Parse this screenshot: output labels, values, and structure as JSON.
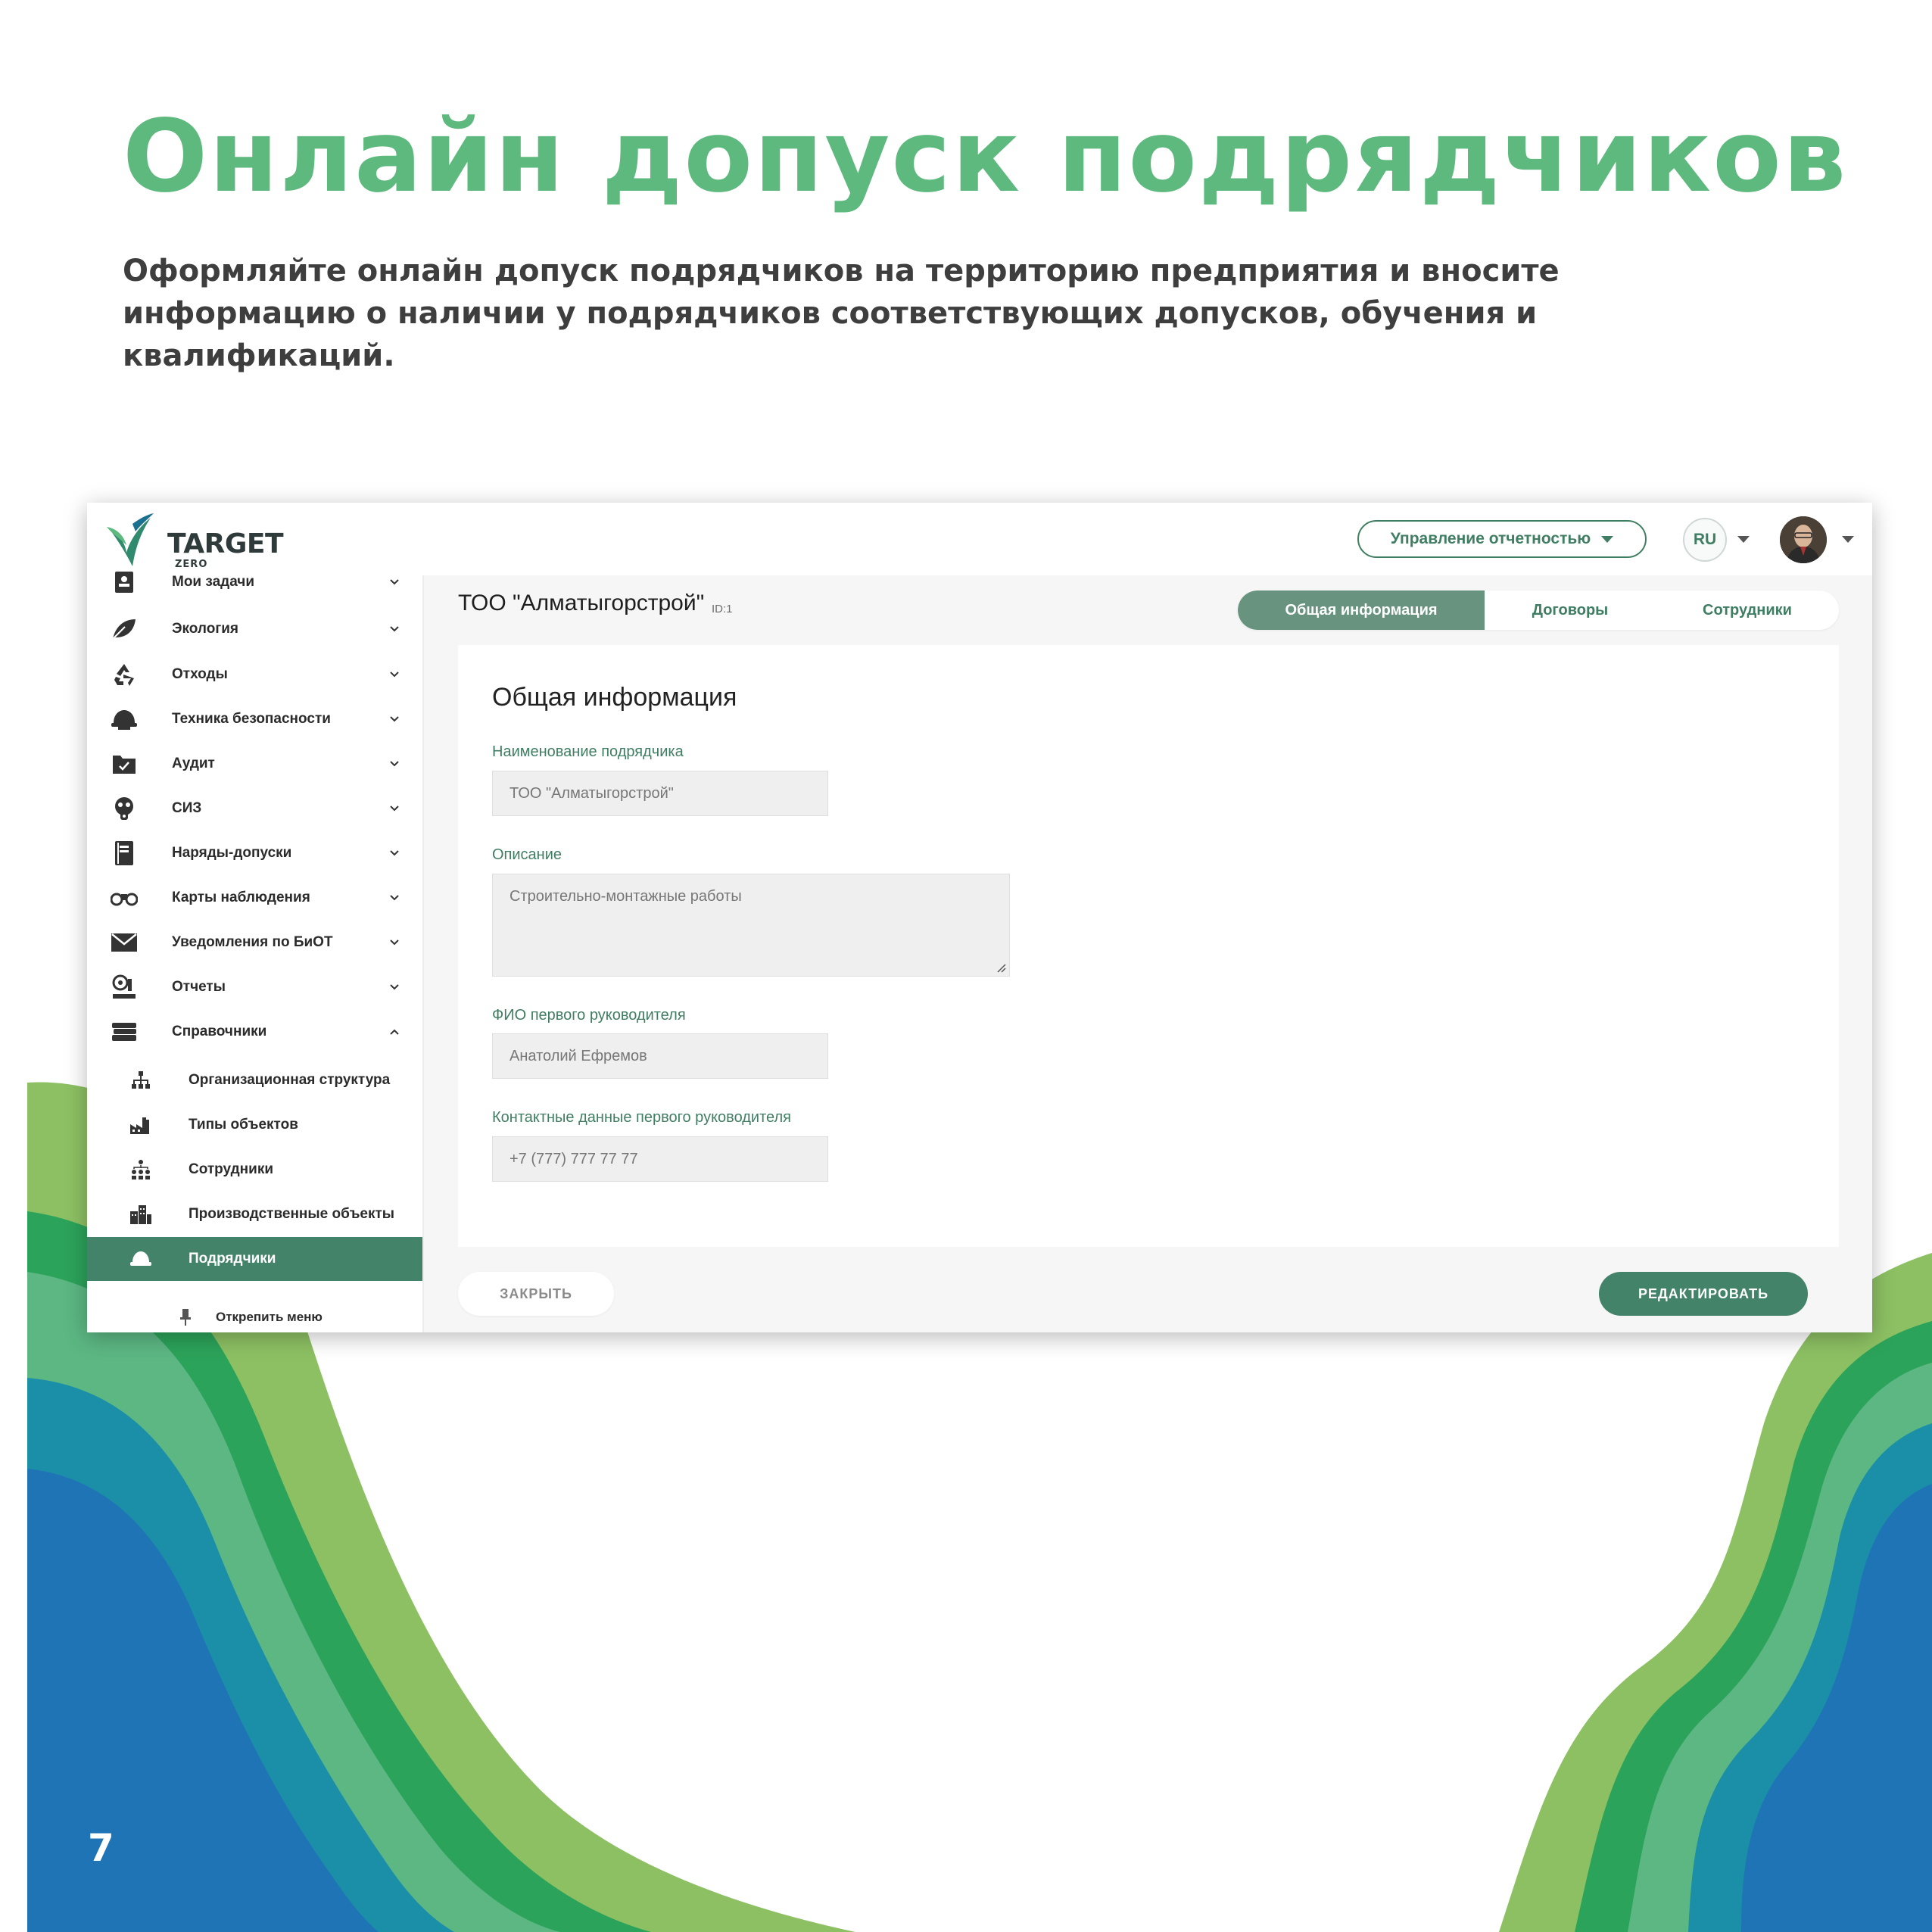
{
  "slide": {
    "headline": "Онлайн допуск подрядчиков",
    "subtitle": "Оформляйте онлайн допуск подрядчиков на территорию предприятия и вносите информацию о наличии у подрядчиков соответствующих допусков, обучения и квалификаций.",
    "page_number": "7"
  },
  "colors": {
    "accent_green": "#5db97d",
    "primary": "#43836a",
    "tab_active": "#68937f"
  },
  "header": {
    "logo_text": "TARGET",
    "logo_sub": "ZERO",
    "report_button": "Управление отчетностью",
    "language": "RU"
  },
  "sidebar": {
    "items": [
      {
        "label": "Мои задачи",
        "icon": "tasks-icon"
      },
      {
        "label": "Экология",
        "icon": "leaf-icon"
      },
      {
        "label": "Отходы",
        "icon": "recycle-icon"
      },
      {
        "label": "Техника безопасности",
        "icon": "hardhat-icon"
      },
      {
        "label": "Аудит",
        "icon": "audit-icon"
      },
      {
        "label": "СИЗ",
        "icon": "gasmask-icon"
      },
      {
        "label": "Наряды-допуски",
        "icon": "document-icon"
      },
      {
        "label": "Карты наблюдения",
        "icon": "binoculars-icon"
      },
      {
        "label": "Уведомления по БиОТ",
        "icon": "envelope-icon"
      },
      {
        "label": "Отчеты",
        "icon": "report-icon"
      },
      {
        "label": "Справочники",
        "icon": "books-icon"
      }
    ],
    "sub_items": [
      {
        "label": "Организационная структура",
        "icon": "org-structure-icon"
      },
      {
        "label": "Типы объектов",
        "icon": "factory-icon"
      },
      {
        "label": "Сотрудники",
        "icon": "employees-icon"
      },
      {
        "label": "Производственные объекты",
        "icon": "buildings-icon"
      },
      {
        "label": "Подрядчики",
        "icon": "helmet-icon"
      }
    ],
    "unpin_label": "Открепить меню"
  },
  "main": {
    "company_title": "ТОО \"Алматыгорстрой\"",
    "company_id": "ID:1",
    "tabs": [
      "Общая информация",
      "Договоры",
      "Сотрудники"
    ],
    "card_title": "Общая информация",
    "fields": {
      "name_label": "Наименование подрядчика",
      "name_value": "ТОО \"Алматыгорстрой\"",
      "desc_label": "Описание",
      "desc_value": "Строительно-монтажные работы",
      "head_label": "ФИО первого руководителя",
      "head_value": "Анатолий Ефремов",
      "contact_label": "Контактные данные первого руководителя",
      "contact_value": "+7 (777) 777 77 77"
    },
    "close_button": "ЗАКРЫТЬ",
    "edit_button": "РЕДАКТИРОВАТЬ"
  }
}
